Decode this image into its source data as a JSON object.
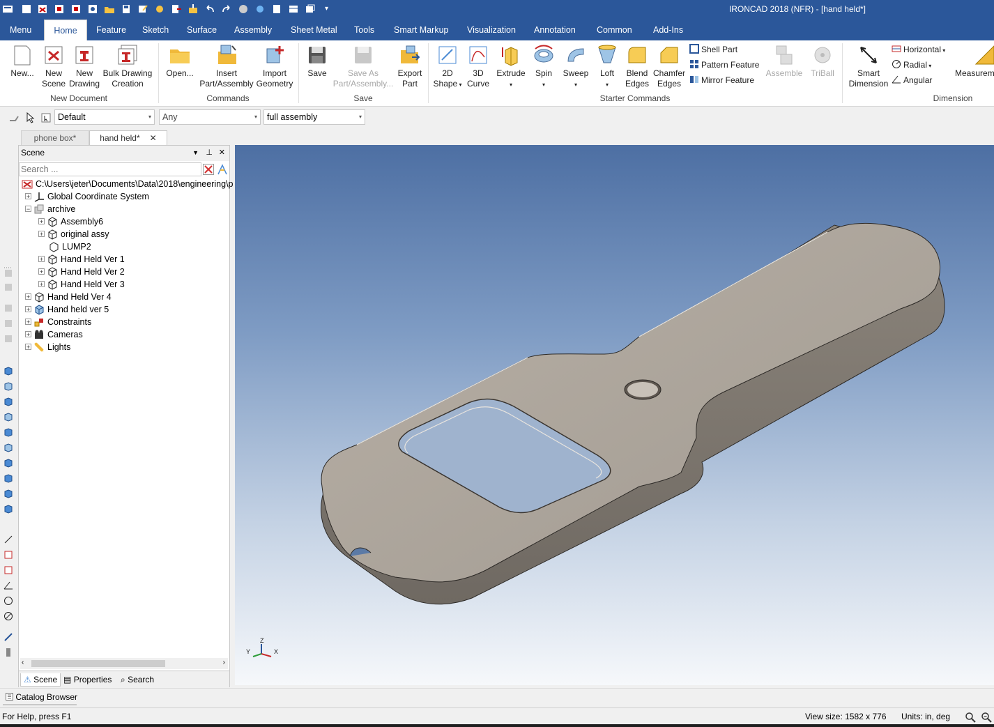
{
  "app": {
    "title": "IRONCAD 2018 (NFR) - [hand held*]"
  },
  "ribbon_tabs": [
    "Menu",
    "Home",
    "Feature",
    "Sketch",
    "Surface",
    "Assembly",
    "Sheet Metal",
    "Tools",
    "Smart Markup",
    "Visualization",
    "Annotation",
    "Common",
    "Add-Ins"
  ],
  "ribbon": {
    "new": "New...",
    "new_scene": [
      "New",
      "Scene"
    ],
    "new_drawing": [
      "New",
      "Drawing"
    ],
    "bulk_drawing": [
      "Bulk Drawing",
      "Creation"
    ],
    "group_new_document": "New Document",
    "open": "Open...",
    "insert": [
      "Insert",
      "Part/Assembly"
    ],
    "import": [
      "Import",
      "Geometry"
    ],
    "group_commands": "Commands",
    "save": "Save",
    "save_as": [
      "Save As",
      "Part/Assembly..."
    ],
    "export": [
      "Export",
      "Part"
    ],
    "group_save": "Save",
    "shape2d": [
      "2D",
      "Shape"
    ],
    "curve3d": [
      "3D",
      "Curve"
    ],
    "extrude": "Extrude",
    "spin": "Spin",
    "sweep": "Sweep",
    "loft": "Loft",
    "blend": [
      "Blend",
      "Edges"
    ],
    "chamfer": [
      "Chamfer",
      "Edges"
    ],
    "shell_part": "Shell Part",
    "pattern_feature": "Pattern Feature",
    "mirror_feature": "Mirror Feature",
    "assemble": "Assemble",
    "triball": "TriBall",
    "group_starter": "Starter Commands",
    "smart_dimension": [
      "Smart",
      "Dimension"
    ],
    "horizontal": "Horizontal",
    "radial": "Radial",
    "angular": "Angular",
    "measurement": "Measurem",
    "group_dimension": "Dimension"
  },
  "toolbar2": {
    "style": "Default",
    "filter": "Any",
    "scope": "full assembly"
  },
  "doc_tabs": {
    "tab1": "phone box*",
    "tab2": "hand held*"
  },
  "scene_panel": {
    "title": "Scene",
    "search_placeholder": "Search ...",
    "tree": [
      {
        "label": "C:\\Users\\jeter\\Documents\\Data\\2018\\engineering\\p"
      },
      {
        "label": "Global Coordinate System"
      },
      {
        "label": "archive"
      },
      {
        "label": "Assembly6"
      },
      {
        "label": "original assy"
      },
      {
        "label": "LUMP2"
      },
      {
        "label": "Hand Held Ver 1"
      },
      {
        "label": "Hand Held Ver 2"
      },
      {
        "label": "Hand Held Ver 3"
      },
      {
        "label": "Hand Held Ver 4"
      },
      {
        "label": "Hand held ver 5"
      },
      {
        "label": "Constraints"
      },
      {
        "label": "Cameras"
      },
      {
        "label": "Lights"
      }
    ],
    "bottom_tabs": [
      "Scene",
      "Properties",
      "Search"
    ]
  },
  "catalog_browser": "Catalog Browser",
  "status": {
    "help": "For Help, press F1",
    "view_size": "View size: 1582 x  776",
    "units": "Units: in, deg"
  },
  "axis": {
    "z": "Z",
    "y": "Y",
    "x": "X"
  }
}
